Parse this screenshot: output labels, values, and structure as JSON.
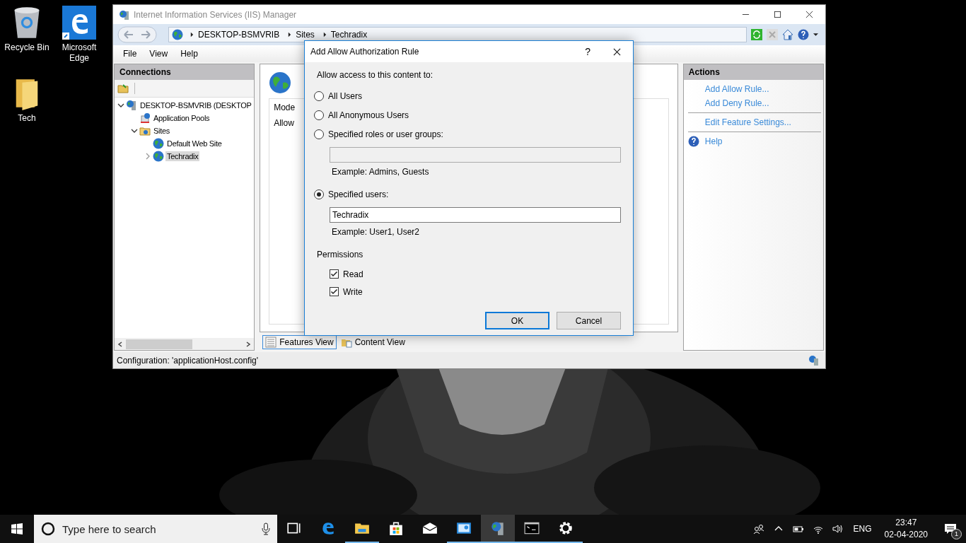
{
  "desktop_icons": [
    {
      "kind": "recycle",
      "label": "Recycle Bin"
    },
    {
      "kind": "edge",
      "label": "Microsoft Edge"
    },
    {
      "kind": "folder",
      "label": "Tech"
    }
  ],
  "iis": {
    "title": "Internet Information Services (IIS) Manager",
    "address": [
      "DESKTOP-BSMVRIB",
      "Sites",
      "Techradix"
    ],
    "menu": [
      "File",
      "View",
      "Help"
    ],
    "connections": {
      "title": "Connections",
      "tree": [
        {
          "label": "DESKTOP-BSMVRIB (DESKTOP",
          "kind": "server",
          "expanded": true,
          "selected": false,
          "children": [
            {
              "label": "Application Pools",
              "kind": "pools",
              "selected": false
            },
            {
              "label": "Sites",
              "kind": "sites",
              "expanded": true,
              "selected": false,
              "children": [
                {
                  "label": "Default Web Site",
                  "kind": "site",
                  "selected": false
                },
                {
                  "label": "Techradix",
                  "kind": "site",
                  "expanded": false,
                  "selected": true
                }
              ]
            }
          ]
        }
      ]
    },
    "center": {
      "rows": [
        "Mode",
        "Allow"
      ]
    },
    "view_tabs": [
      {
        "label": "Features View",
        "selected": true
      },
      {
        "label": "Content View",
        "selected": false
      }
    ],
    "actions": {
      "title": "Actions",
      "groups": [
        [
          {
            "label": "Add Allow Rule...",
            "kind": "link"
          },
          {
            "label": "Add Deny Rule...",
            "kind": "link"
          }
        ],
        [
          {
            "label": "Edit Feature Settings...",
            "kind": "link"
          }
        ],
        [
          {
            "label": "Help",
            "kind": "help"
          }
        ]
      ]
    },
    "status_bar": "Configuration: 'applicationHost.config'"
  },
  "dialog": {
    "title": "Add Allow Authorization Rule",
    "help_glyph": "?",
    "prompt": "Allow access to this content to:",
    "options": [
      {
        "label": "All Users",
        "selected": false
      },
      {
        "label": "All Anonymous Users",
        "selected": false
      },
      {
        "label": "Specified roles or user groups:",
        "selected": false,
        "field": {
          "disabled": true
        },
        "example": "Example: Admins, Guests"
      },
      {
        "label": "Specified users:",
        "selected": true,
        "field": {
          "value": "Techradix",
          "disabled": false
        },
        "example": "Example: User1, User2"
      }
    ],
    "permissions_title": "Permissions",
    "permissions": [
      {
        "label": "Read",
        "checked": true
      },
      {
        "label": "Write",
        "checked": true
      }
    ],
    "buttons": [
      {
        "label": "OK",
        "default": true
      },
      {
        "label": "Cancel",
        "default": false
      }
    ]
  },
  "taskbar": {
    "search_placeholder": "Type here to search",
    "apps": [
      {
        "kind": "taskview",
        "running": false,
        "selected": false
      },
      {
        "kind": "edge",
        "running": false,
        "selected": false
      },
      {
        "kind": "explorer",
        "running": true,
        "selected": false
      },
      {
        "kind": "store",
        "running": false,
        "selected": false
      },
      {
        "kind": "mail",
        "running": false,
        "selected": false
      },
      {
        "kind": "panel",
        "running": true,
        "selected": false
      },
      {
        "kind": "iis",
        "running": true,
        "selected": true
      },
      {
        "kind": "cmd",
        "running": true,
        "selected": false
      },
      {
        "kind": "settings",
        "running": true,
        "selected": false
      }
    ],
    "language": "ENG",
    "time": "23:47",
    "date": "02-04-2020",
    "notifications": "1"
  }
}
